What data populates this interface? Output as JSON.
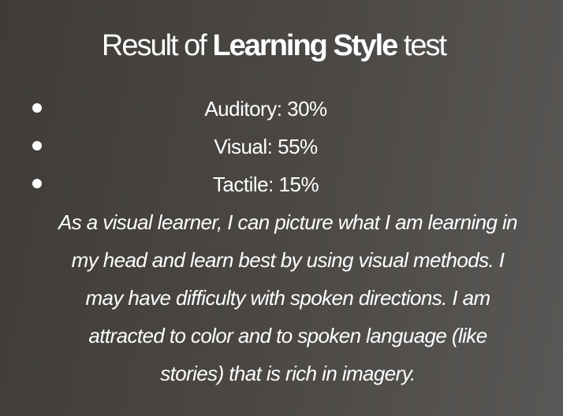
{
  "title": {
    "prefix": "Result of ",
    "emphasis": "Learning Style",
    "suffix": " test"
  },
  "results": [
    {
      "label": "Auditory: 30%",
      "category": "Auditory",
      "percent": 30
    },
    {
      "label": "Visual: 55%",
      "category": "Visual",
      "percent": 55
    },
    {
      "label": "Tactile: 15%",
      "category": "Tactile",
      "percent": 15
    }
  ],
  "description": "As a visual learner, I can picture what I am learning in my head and learn best by using visual methods. I may have difficulty with spoken directions. I am attracted to color and to spoken language (like stories) that is rich in imagery.",
  "colors": {
    "text": "#ffffff",
    "background_dark": "#3f3c38",
    "background_light": "#5a5856"
  }
}
